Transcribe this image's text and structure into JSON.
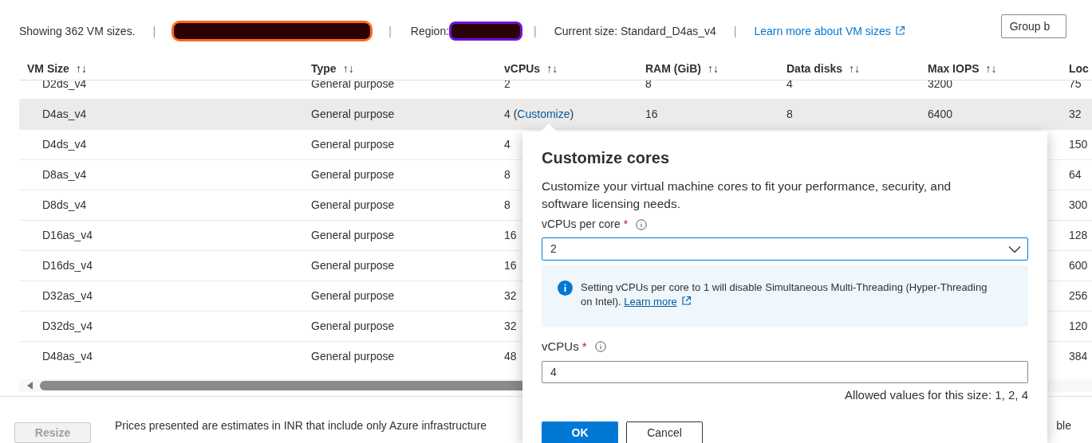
{
  "summary": {
    "count": "Showing 362 VM sizes.",
    "separator": "|",
    "region_label": "Region:",
    "current_size": "Current size: Standard_D4as_v4",
    "learn_more": "Learn more about VM sizes",
    "group_by": "Group b"
  },
  "table": {
    "columns": [
      "VM Size",
      "Type",
      "vCPUs",
      "RAM (GiB)",
      "Data disks",
      "Max IOPS",
      "Loc"
    ],
    "sort_glyph": "↑↓",
    "rows": [
      {
        "selected": false,
        "cells": [
          "D2ds_v4",
          "General purpose",
          "2",
          "8",
          "4",
          "3200",
          "75"
        ]
      },
      {
        "selected": true,
        "cells": [
          "D4as_v4",
          "General purpose",
          "4 (",
          "16",
          "8",
          "6400",
          "32"
        ],
        "link": "Customize",
        "link_after": ")"
      },
      {
        "selected": false,
        "cells": [
          "D4ds_v4",
          "General purpose",
          "4",
          null,
          null,
          null,
          "150"
        ]
      },
      {
        "selected": false,
        "cells": [
          "D8as_v4",
          "General purpose",
          "8",
          null,
          null,
          null,
          "64"
        ]
      },
      {
        "selected": false,
        "cells": [
          "D8ds_v4",
          "General purpose",
          "8",
          null,
          null,
          null,
          "300"
        ]
      },
      {
        "selected": false,
        "cells": [
          "D16as_v4",
          "General purpose",
          "16",
          null,
          null,
          null,
          "128"
        ]
      },
      {
        "selected": false,
        "cells": [
          "D16ds_v4",
          "General purpose",
          "16",
          null,
          null,
          null,
          "600"
        ]
      },
      {
        "selected": false,
        "cells": [
          "D32as_v4",
          "General purpose",
          "32",
          null,
          null,
          null,
          "256"
        ]
      },
      {
        "selected": false,
        "cells": [
          "D32ds_v4",
          "General purpose",
          "32",
          null,
          null,
          null,
          "120"
        ]
      },
      {
        "selected": false,
        "cells": [
          "D48as_v4",
          "General purpose",
          "48",
          null,
          null,
          null,
          "384"
        ]
      }
    ]
  },
  "footer": {
    "resize": {
      "label": "Resize",
      "disabled": true
    },
    "note": "Prices presented are estimates in INR that include only Azure infrastructure",
    "note_tail": "ble"
  },
  "popup": {
    "title": "Customize cores",
    "description": "Customize your virtual machine cores to fit your performance, security, and software licensing needs.",
    "per_core": {
      "label": "vCPUs per core",
      "required": "*",
      "value": "2"
    },
    "info": {
      "text": "Setting vCPUs per core to 1 will disable Simultaneous Multi-Threading (Hyper-Threading on Intel).",
      "link": "Learn more"
    },
    "vcpus": {
      "label": "vCPUs",
      "required": "*",
      "value": "4",
      "hint": "Allowed values for this size: 1, 2, 4"
    },
    "ok": "OK",
    "cancel": "Cancel"
  }
}
